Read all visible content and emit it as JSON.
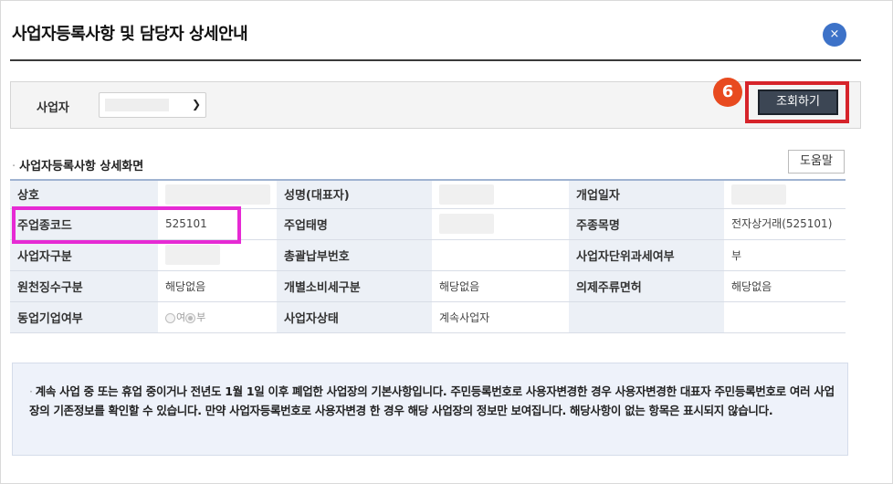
{
  "dialog": {
    "title": "사업자등록사항 및 담당자 상세안내",
    "close_label": "×"
  },
  "search": {
    "label": "사업자",
    "button_label": "조회하기",
    "step_number": "6"
  },
  "section": {
    "bullet": "·",
    "title": "사업자등록사항 상세화면",
    "help_label": "도움말"
  },
  "table": {
    "rows": [
      [
        {
          "label": "상호",
          "value": ""
        },
        {
          "label": "성명(대표자)",
          "value": ""
        },
        {
          "label": "개업일자",
          "value": ""
        }
      ],
      [
        {
          "label": "주업종코드",
          "value": "525101"
        },
        {
          "label": "주업태명",
          "value": ""
        },
        {
          "label": "주종목명",
          "value": "전자상거래(525101)"
        }
      ],
      [
        {
          "label": "사업자구분",
          "value": ""
        },
        {
          "label": "총괄납부번호",
          "value": ""
        },
        {
          "label": "사업자단위과세여부",
          "value": "부"
        }
      ],
      [
        {
          "label": "원천징수구분",
          "value": "해당없음"
        },
        {
          "label": "개별소비세구분",
          "value": "해당없음"
        },
        {
          "label": "의제주류면허",
          "value": "해당없음"
        }
      ],
      [
        {
          "label": "동업기업여부",
          "options": [
            "여",
            "부"
          ],
          "selected": "부"
        },
        {
          "label": "사업자상태",
          "value": "계속사업자"
        },
        {
          "label": "",
          "value": ""
        }
      ]
    ]
  },
  "notice": {
    "bullet": "·",
    "text": "계속 사업 중 또는 휴업 중이거나 전년도 1월 1일 이후 폐업한 사업장의 기본사항입니다. 주민등록번호로 사용자변경한 경우 사용자변경한 대표자 주민등록번호로 여러 사업장의 기존정보를 확인할 수 있습니다. 만약 사업자등록번호로 사용자변경 한 경우 해당 사업장의 정보만 보여집니다. 해당사항이 없는 항목은 표시되지 않습니다."
  },
  "colors": {
    "close_button": "#3d72c8",
    "step_badge": "#e84a1f",
    "button_highlight": "#d6232a",
    "code_highlight": "#e62ad4",
    "header_cell_bg": "#ecf0f6",
    "search_button_bg": "#3c4654"
  },
  "icons": {
    "close": "close-icon",
    "dropdown": "chevron-down-icon"
  }
}
